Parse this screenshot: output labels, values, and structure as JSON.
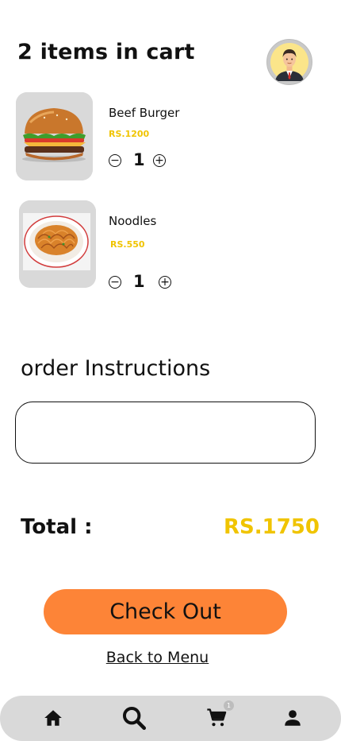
{
  "header": {
    "title": "2 items in cart"
  },
  "cart": {
    "items": [
      {
        "name": "Beef Burger",
        "price": "RS.1200",
        "quantity": "1"
      },
      {
        "name": "Noodles",
        "price": "RS.550",
        "quantity": "1"
      }
    ]
  },
  "instructions": {
    "title": "order Instructions",
    "value": ""
  },
  "summary": {
    "total_label": "Total :",
    "total_value": "RS.1750"
  },
  "actions": {
    "checkout_label": "Check Out",
    "back_label": "Back to Menu"
  },
  "nav": {
    "cart_badge": "1"
  },
  "colors": {
    "accent_orange": "#fd8437",
    "price_yellow": "#f0c400",
    "nav_bg": "#d9d9d9"
  }
}
